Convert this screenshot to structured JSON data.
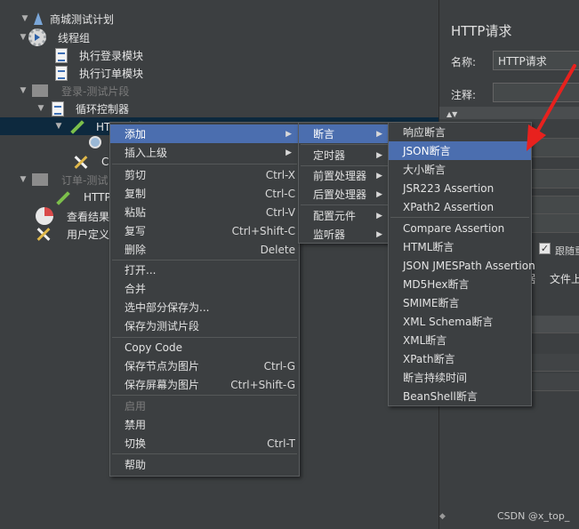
{
  "tree": {
    "rows": [
      {
        "arrow": "▼",
        "icon": "flask-icon",
        "label": "商城测试计划",
        "disabled": false
      },
      {
        "arrow": "▼",
        "icon": "gear-icon",
        "label": "线程组",
        "disabled": false
      },
      {
        "arrow": "",
        "icon": "script-icon",
        "label": "执行登录模块",
        "disabled": false
      },
      {
        "arrow": "",
        "icon": "script-icon",
        "label": "执行订单模块",
        "disabled": false
      },
      {
        "arrow": "▼",
        "icon": "fragment-icon",
        "label": "登录-测试片段",
        "disabled": true
      },
      {
        "arrow": "▼",
        "icon": "script-icon",
        "label": "循环控制器",
        "disabled": false
      },
      {
        "arrow": "▼",
        "icon": "pen-icon",
        "label": "HTTP请求",
        "disabled": false
      },
      {
        "arrow": "",
        "icon": "magnifier-icon",
        "label": "",
        "disabled": false
      },
      {
        "arrow": "",
        "icon": "cross-tools-icon",
        "label": "C",
        "disabled": false
      },
      {
        "arrow": "▼",
        "icon": "fragment-icon",
        "label": "订单-测试",
        "disabled": true
      },
      {
        "arrow": "",
        "icon": "pen-icon",
        "label": "HTTP",
        "disabled": false
      },
      {
        "arrow": "",
        "icon": "pie-icon",
        "label": "查看结果",
        "disabled": false
      },
      {
        "arrow": "",
        "icon": "cross-tools-icon",
        "label": "用户定义",
        "disabled": false
      }
    ]
  },
  "right_panel": {
    "title": "HTTP请求",
    "name_label": "名称:",
    "name_value": "HTTP请求",
    "comment_label": "注释:",
    "follow_label": "跟随重",
    "data_tab": "据",
    "file_tab": "文件上"
  },
  "menu_main": {
    "items": [
      {
        "label": "添加",
        "shortcut": "",
        "submenu": true,
        "highlight": true,
        "disabled": false
      },
      {
        "label": "插入上级",
        "shortcut": "",
        "submenu": true,
        "highlight": false,
        "disabled": false
      },
      {
        "label": "剪切",
        "shortcut": "Ctrl-X",
        "submenu": false,
        "highlight": false,
        "disabled": false
      },
      {
        "label": "复制",
        "shortcut": "Ctrl-C",
        "submenu": false,
        "highlight": false,
        "disabled": false
      },
      {
        "label": "粘贴",
        "shortcut": "Ctrl-V",
        "submenu": false,
        "highlight": false,
        "disabled": false
      },
      {
        "label": "复写",
        "shortcut": "Ctrl+Shift-C",
        "submenu": false,
        "highlight": false,
        "disabled": false
      },
      {
        "label": "删除",
        "shortcut": "Delete",
        "submenu": false,
        "highlight": false,
        "disabled": false
      },
      {
        "label": "打开...",
        "shortcut": "",
        "submenu": false,
        "highlight": false,
        "disabled": false
      },
      {
        "label": "合并",
        "shortcut": "",
        "submenu": false,
        "highlight": false,
        "disabled": false
      },
      {
        "label": "选中部分保存为...",
        "shortcut": "",
        "submenu": false,
        "highlight": false,
        "disabled": false
      },
      {
        "label": "保存为测试片段",
        "shortcut": "",
        "submenu": false,
        "highlight": false,
        "disabled": false
      },
      {
        "label": "Copy Code",
        "shortcut": "",
        "submenu": false,
        "highlight": false,
        "disabled": false
      },
      {
        "label": "保存节点为图片",
        "shortcut": "Ctrl-G",
        "submenu": false,
        "highlight": false,
        "disabled": false
      },
      {
        "label": "保存屏幕为图片",
        "shortcut": "Ctrl+Shift-G",
        "submenu": false,
        "highlight": false,
        "disabled": false
      },
      {
        "label": "启用",
        "shortcut": "",
        "submenu": false,
        "highlight": false,
        "disabled": true
      },
      {
        "label": "禁用",
        "shortcut": "",
        "submenu": false,
        "highlight": false,
        "disabled": false
      },
      {
        "label": "切换",
        "shortcut": "Ctrl-T",
        "submenu": false,
        "highlight": false,
        "disabled": false
      },
      {
        "label": "帮助",
        "shortcut": "",
        "submenu": false,
        "highlight": false,
        "disabled": false
      }
    ]
  },
  "menu_add": {
    "items": [
      {
        "label": "断言",
        "submenu": true,
        "highlight": true
      },
      {
        "label": "定时器",
        "submenu": true,
        "highlight": false
      },
      {
        "label": "前置处理器",
        "submenu": true,
        "highlight": false
      },
      {
        "label": "后置处理器",
        "submenu": true,
        "highlight": false
      },
      {
        "label": "配置元件",
        "submenu": true,
        "highlight": false
      },
      {
        "label": "监听器",
        "submenu": true,
        "highlight": false
      }
    ]
  },
  "menu_assert": {
    "items": [
      {
        "label": "响应断言",
        "highlight": false
      },
      {
        "label": "JSON断言",
        "highlight": true
      },
      {
        "label": "大小断言",
        "highlight": false
      },
      {
        "label": "JSR223 Assertion",
        "highlight": false
      },
      {
        "label": "XPath2 Assertion",
        "highlight": false
      },
      {
        "label": "Compare Assertion",
        "highlight": false
      },
      {
        "label": "HTML断言",
        "highlight": false
      },
      {
        "label": "JSON JMESPath Assertion",
        "highlight": false
      },
      {
        "label": "MD5Hex断言",
        "highlight": false
      },
      {
        "label": "SMIME断言",
        "highlight": false
      },
      {
        "label": "XML Schema断言",
        "highlight": false
      },
      {
        "label": "XML断言",
        "highlight": false
      },
      {
        "label": "XPath断言",
        "highlight": false
      },
      {
        "label": "断言持续时间",
        "highlight": false
      },
      {
        "label": "BeanShell断言",
        "highlight": false
      }
    ]
  },
  "watermark": "CSDN @x_top_",
  "colors": {
    "highlight": "#4b6eaf",
    "annotation_arrow": "#e8211e",
    "selected_row": "#0d293e"
  }
}
